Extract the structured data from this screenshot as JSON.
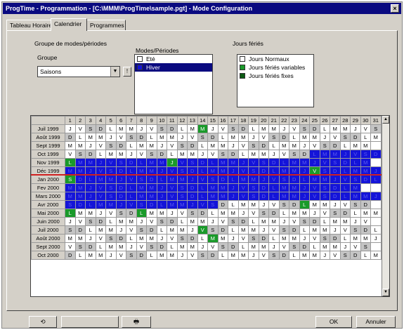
{
  "window": {
    "title": "ProgTime - Programmation - [C:\\MMM\\ProgTime\\sample.pgt] - Mode Configuration",
    "close_glyph": "×"
  },
  "tabs": [
    "Tableau Horaire",
    "Calendrier",
    "Programmes"
  ],
  "active_tab_index": 1,
  "groups": {
    "section_label": "Groupe de modes/périodes",
    "group_label": "Groupe",
    "group_value": "Saisons",
    "arrow_glyph": "▼",
    "side_button": "!"
  },
  "modes": {
    "label": "Modes/Périodes",
    "items": [
      {
        "label": "Eté",
        "color": "#ffffff",
        "selected": false
      },
      {
        "label": "Hiver",
        "color": "#1414d8",
        "selected": true
      }
    ]
  },
  "holidays": {
    "label": "Jours fériés",
    "items": [
      {
        "label": "Jours Normaux",
        "color": "#ffffff"
      },
      {
        "label": "Jours fériés variables",
        "color": "#1a9a2a"
      },
      {
        "label": "Jours fériés fixes",
        "color": "#0b5a12"
      }
    ]
  },
  "calendar": {
    "day_numbers": [
      "1",
      "2",
      "3",
      "4",
      "5",
      "6",
      "7",
      "8",
      "9",
      "10",
      "11",
      "12",
      "13",
      "14",
      "15",
      "16",
      "17",
      "18",
      "19",
      "20",
      "21",
      "22",
      "23",
      "24",
      "25",
      "26",
      "27",
      "28",
      "29",
      "30",
      "31"
    ],
    "months": [
      {
        "label": "Juil 1999",
        "start": "J",
        "days": 31
      },
      {
        "label": "Août 1999",
        "start": "D",
        "days": 31
      },
      {
        "label": "Sept 1999",
        "start": "M",
        "days": 30
      },
      {
        "label": "Oct 1999",
        "start": "V",
        "days": 31
      },
      {
        "label": "Nov 1999",
        "start": "L",
        "days": 30
      },
      {
        "label": "Déc 1999",
        "start": "M",
        "days": 31
      },
      {
        "label": "Jan 2000",
        "start": "S",
        "days": 31
      },
      {
        "label": "Fev 2000",
        "start": "M",
        "days": 29
      },
      {
        "label": "Mars 2000",
        "start": "M",
        "days": 31
      },
      {
        "label": "Avr 2000",
        "start": "S",
        "days": 30
      },
      {
        "label": "Mai 2000",
        "start": "L",
        "days": 31
      },
      {
        "label": "Juin 2000",
        "start": "J",
        "days": 30
      },
      {
        "label": "Juil 2000",
        "start": "S",
        "days": 31
      },
      {
        "label": "Août 2000",
        "start": "M",
        "days": 31
      },
      {
        "label": "Sept 2000",
        "start": "V",
        "days": 30
      },
      {
        "label": "Oct 2000",
        "start": "D",
        "days": 31
      }
    ],
    "winter_period": {
      "start": "Oct 1999 day 25",
      "end": "Avr 2000 day 15"
    },
    "holidays_marked": [
      "Juil 1999 day 14",
      "Nov 1999 day 1",
      "Nov 1999 day 11",
      "Déc 1999 day 25",
      "Jan 2000 day 1",
      "Avr 2000 day 24",
      "Mai 2000 day 1",
      "Mai 2000 day 8",
      "Juil 2000 day 14",
      "Août 2000 day 15"
    ],
    "colors": {
      "winter": "#1414d8",
      "holiday": "#1a9a2a",
      "weekend": "#c4c4c4"
    }
  },
  "buttons": {
    "undo": "⟲",
    "blank": "",
    "print": "🖶",
    "ok": "OK",
    "cancel": "Annuler"
  }
}
